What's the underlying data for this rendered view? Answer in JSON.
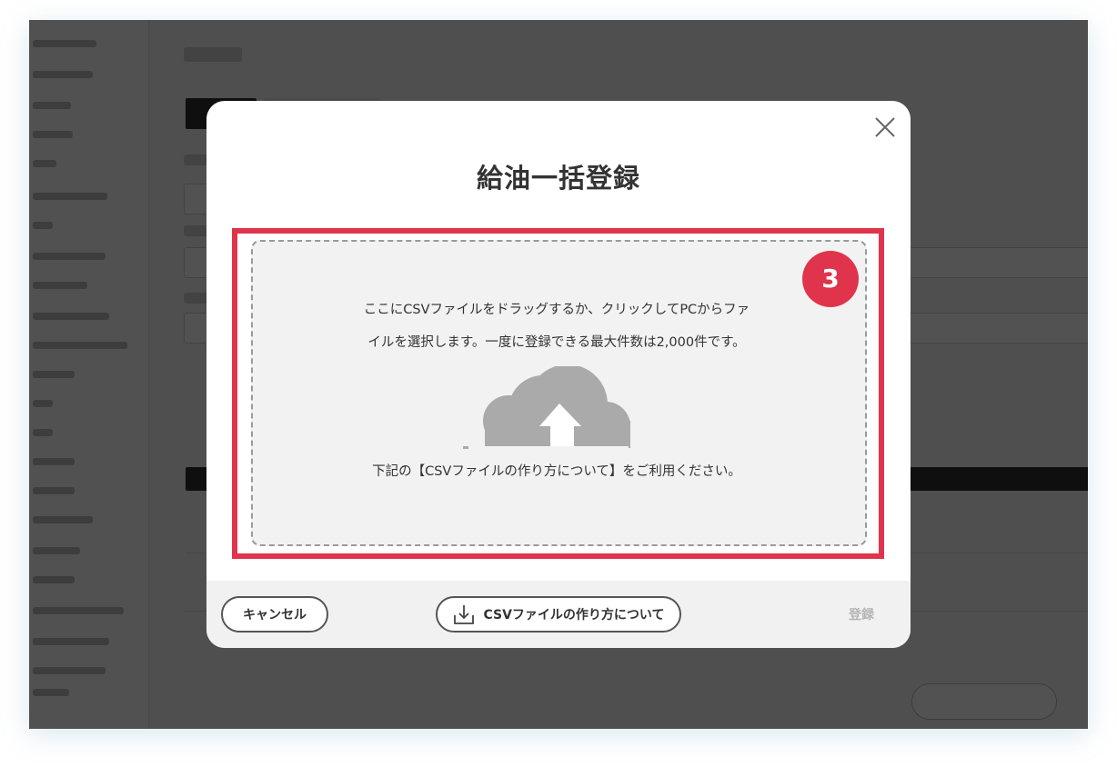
{
  "modal": {
    "title": "給油一括登録",
    "step_badge": "3",
    "dropzone": {
      "line1": "ここにCSVファイルをドラッグするか、クリックしてPCからファ",
      "line2": "イルを選択します。一度に登録できる最大件数は2,000件です。",
      "line3": "下記の【CSVファイルの作り方について】をご利用ください。",
      "icon": "cloud-upload-icon"
    },
    "footer": {
      "cancel_label": "キャンセル",
      "howto_label": "CSVファイルの作り方について",
      "register_label": "登録"
    }
  },
  "colors": {
    "highlight": "#e0344c",
    "overlay": "rgba(0,0,0,0.68)",
    "cloud": "#aaaaaa"
  }
}
